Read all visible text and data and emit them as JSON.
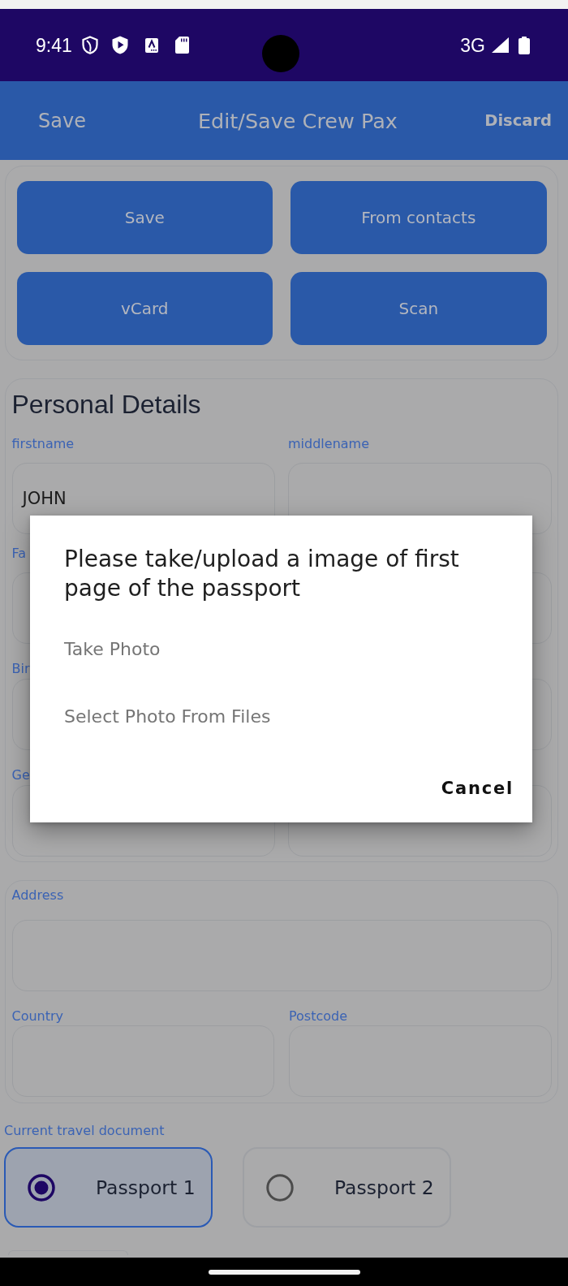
{
  "status_bar": {
    "time": "9:41",
    "network": "3G"
  },
  "app_bar": {
    "left_action": "Save",
    "title": "Edit/Save Crew Pax",
    "right_action": "Discard"
  },
  "actions": [
    "Save",
    "From contacts",
    "vCard",
    "Scan"
  ],
  "personal_details": {
    "heading": "Personal Details",
    "rows": [
      {
        "left": {
          "label": "firstname",
          "value": "JOHN"
        },
        "right": {
          "label": "middlename"
        }
      },
      {
        "left": {
          "label": "Fa"
        }
      },
      {
        "left": {
          "label": "Bir"
        }
      },
      {
        "left": {
          "label": "Ge"
        }
      }
    ]
  },
  "address": {
    "label": "Address",
    "country_label": "Country",
    "postcode_label": "Postcode"
  },
  "travel_document": {
    "label": "Current travel document",
    "options": [
      {
        "label": "Passport 1",
        "selected": true
      },
      {
        "label": "Passport 2",
        "selected": false
      }
    ]
  },
  "dialog": {
    "title": "Please take/upload a image of first page of the passport",
    "options": [
      "Take Photo",
      "Select Photo From Files"
    ],
    "cancel": "Cancel"
  }
}
